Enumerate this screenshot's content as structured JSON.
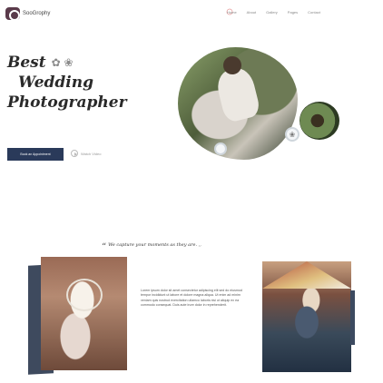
{
  "header": {
    "brand": "SooGrophy",
    "nav": [
      "Home",
      "About",
      "Gallery",
      "Pages",
      "Contact"
    ]
  },
  "hero": {
    "title_line1": "Best",
    "title_line2": "Wedding",
    "title_line3": "Photographer",
    "cta_label": "Book an Appointment",
    "watch_label": "Watch Video"
  },
  "quote": {
    "mark": "“",
    "text": "We capture your moments as they are. ,,"
  },
  "gallery": {
    "card_text": "Lorem ipsum dolor sit amet consectetur adipiscing elit sed do eiusmod tempor incididunt ut labore et dolore magna aliqua. Ut enim ad minim veniam quis nostrud exercitation ullamco laboris nisi ut aliquip ex ea commodo consequat. Duis aute irure dolor in reprehenderit."
  },
  "colors": {
    "accent": "#2a3a5a",
    "logo": "#5a3a4a"
  },
  "icons": {
    "logo": "camera-lens-icon",
    "title_deco": "floral-ring-icon",
    "play": "play-icon"
  }
}
